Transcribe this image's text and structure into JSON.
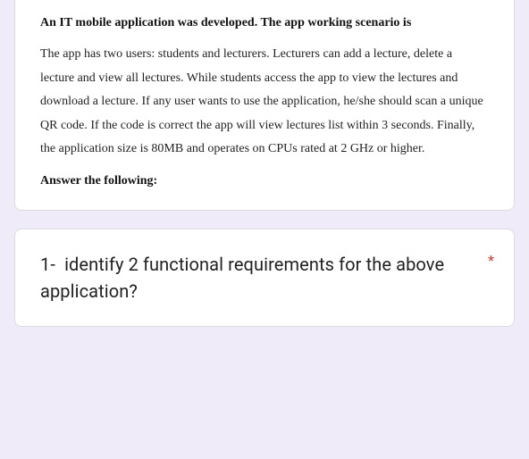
{
  "scenario": {
    "title": "An IT mobile application was developed. The app working scenario is",
    "body": "The app has two users: students and lecturers. Lecturers can add a lecture, delete a lecture and view all lectures. While students access the app to view the lectures and download a lecture. If any user wants to use the application, he/she should scan a unique QR code. If the code is correct the app will view lectures list within 3 seconds. Finally, the application size is 80MB and operates on CPUs rated at 2 GHz or higher.",
    "answer_label": "Answer the following:"
  },
  "question": {
    "number": "1-",
    "text": "identify 2 functional requirements for the above application?",
    "required_marker": "*"
  }
}
